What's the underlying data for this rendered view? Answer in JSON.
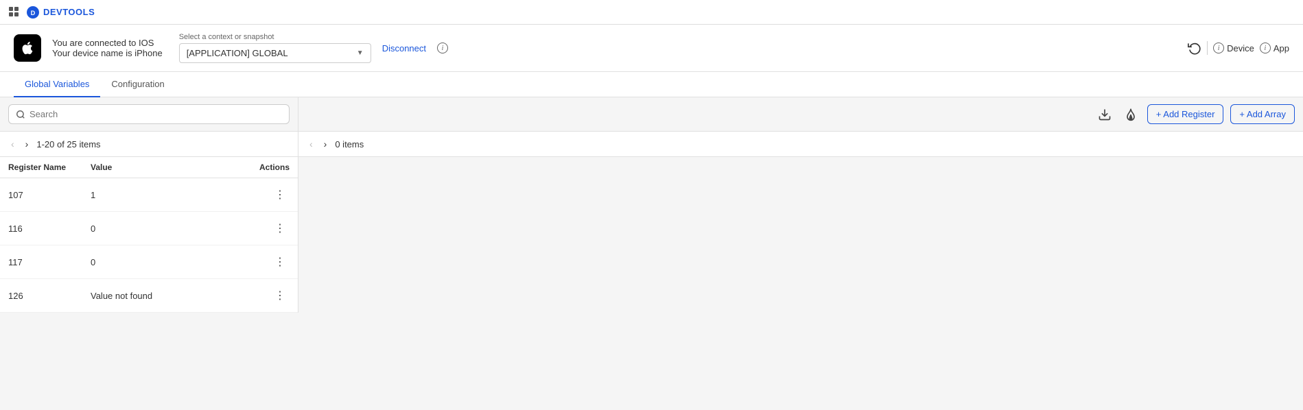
{
  "topbar": {
    "app_name": "DEVTOOLS"
  },
  "header": {
    "connected_line1": "You are connected to IOS",
    "connected_line2": "Your device name is iPhone",
    "context_label": "Select a context or snapshot",
    "context_value": "[APPLICATION] GLOBAL",
    "disconnect_label": "Disconnect",
    "history_icon": "history-icon",
    "device_label": "Device",
    "app_label": "App"
  },
  "tabs": [
    {
      "id": "global-variables",
      "label": "Global Variables",
      "active": true
    },
    {
      "id": "configuration",
      "label": "Configuration",
      "active": false
    }
  ],
  "toolbar": {
    "search_placeholder": "Search",
    "add_register_label": "+ Add Register",
    "add_array_label": "+ Add Array"
  },
  "left_pagination": {
    "items_text": "1-20 of 25 items"
  },
  "right_pagination": {
    "items_text": "0 items"
  },
  "table": {
    "columns": [
      "Register Name",
      "Value",
      "Actions"
    ],
    "rows": [
      {
        "name": "107",
        "value": "1"
      },
      {
        "name": "116",
        "value": "0"
      },
      {
        "name": "117",
        "value": "0"
      },
      {
        "name": "126",
        "value": "Value not found"
      }
    ]
  },
  "colors": {
    "accent": "#1a56db",
    "border": "#e0e0e0",
    "bg": "#f5f5f5"
  }
}
